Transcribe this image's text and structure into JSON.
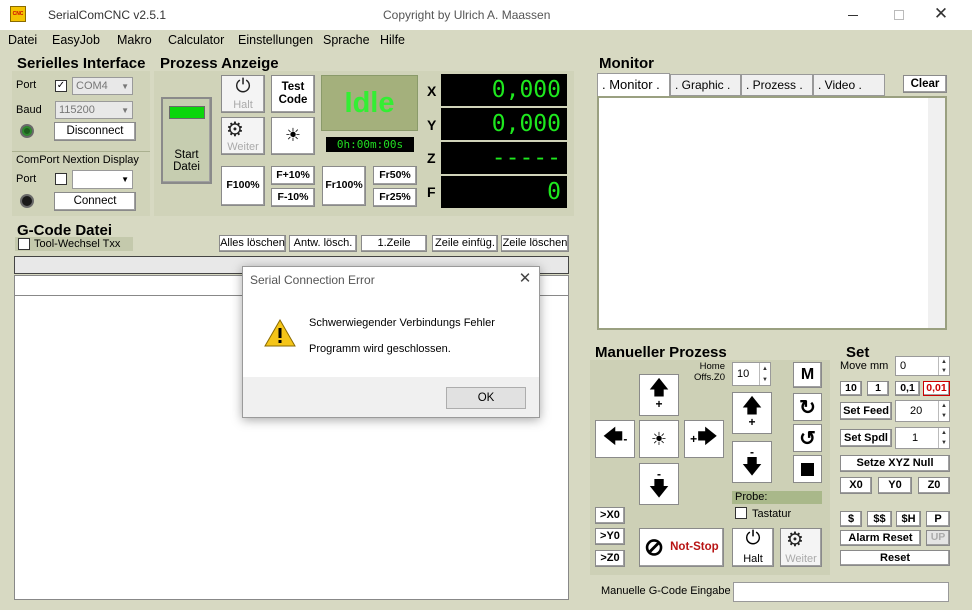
{
  "window": {
    "title": "SerialComCNC  v2.5.1",
    "copyright": "Copyright by Ulrich A. Maassen",
    "logo_text": "CNC"
  },
  "menu": [
    "Datei",
    "EasyJob",
    "Makro",
    "Calculator",
    "Einstellungen",
    "Sprache",
    "Hilfe"
  ],
  "serial": {
    "heading": "Serielles Interface",
    "port_label": "Port",
    "port_value": "COM4",
    "baud_label": "Baud",
    "baud_value": "115200",
    "disconnect_label": "Disconnect",
    "nextion_label": "ComPort Nextion Display",
    "port2_label": "Port",
    "port2_value": "",
    "connect_label": "Connect"
  },
  "process": {
    "heading": "Prozess Anzeige",
    "start_label": "Start\nDatei",
    "halt_label": "Halt",
    "test_label": "Test\nCode",
    "weiter_label": "Weiter",
    "status": "Idle",
    "timer": "0h:00m:00s",
    "f100": "F100%",
    "fplus": "F+10%",
    "fminus": "F-10%",
    "fr100": "Fr100%",
    "fr50": "Fr50%",
    "fr25": "Fr25%",
    "axes": [
      {
        "label": "X",
        "value": "0,000"
      },
      {
        "label": "Y",
        "value": "0,000"
      },
      {
        "label": "Z",
        "value": "-----"
      },
      {
        "label": "F",
        "value": "0"
      }
    ]
  },
  "gcode": {
    "heading": "G-Code Datei",
    "tool_change": "Tool-Wechsel Txx",
    "buttons": [
      "Alles löschen",
      "Antw. lösch.",
      "1.Zeile",
      "Zeile einfüg.",
      "Zeile löschen"
    ]
  },
  "monitor": {
    "heading": "Monitor",
    "tabs": [
      ". Monitor .",
      ". Graphic .",
      ". Prozess .",
      ". Video ."
    ],
    "clear_label": "Clear"
  },
  "manual": {
    "heading": "Manueller Prozess",
    "home_label": "Home\nOffs.Z0",
    "step_value": "10",
    "m_label": "M",
    "probe_label": "Probe:",
    "tastatur_label": "Tastatur",
    "x0": ">X0",
    "y0": ">Y0",
    "z0": ">Z0",
    "notstop_label": "Not-Stop",
    "halt_label": "Halt",
    "weiter_label": "Weiter",
    "plus": "+",
    "minus": "-",
    "gcode_input_label": "Manuelle G-Code Eingabe"
  },
  "set": {
    "heading": "Set",
    "move_label": "Move mm",
    "move_value": "0",
    "step_buttons": [
      "10",
      "1",
      "0,1",
      "0,01"
    ],
    "feed_label": "Set Feed",
    "feed_value": "20",
    "spdl_label": "Set Spdl",
    "spdl_value": "1",
    "setze_label": "Setze XYZ Null",
    "zero_buttons": [
      "X0",
      "Y0",
      "Z0"
    ],
    "cmd_buttons": [
      "$",
      "$$",
      "$H",
      "P"
    ],
    "alarm_label": "Alarm Reset",
    "up_label": "UP",
    "reset_label": "Reset"
  },
  "dialog": {
    "title": "Serial Connection Error",
    "message1": "Schwerwiegender Verbindungs Fehler",
    "message2": "Programm wird geschlossen.",
    "ok_label": "OK"
  },
  "colors": {
    "bg": "#d7d9c2",
    "lcd_text": "#1ee81e",
    "idle_bg": "#a4b07c",
    "idle_text": "#33ee33",
    "notstop_red": "#b81414",
    "select_red": "#cc0000"
  }
}
